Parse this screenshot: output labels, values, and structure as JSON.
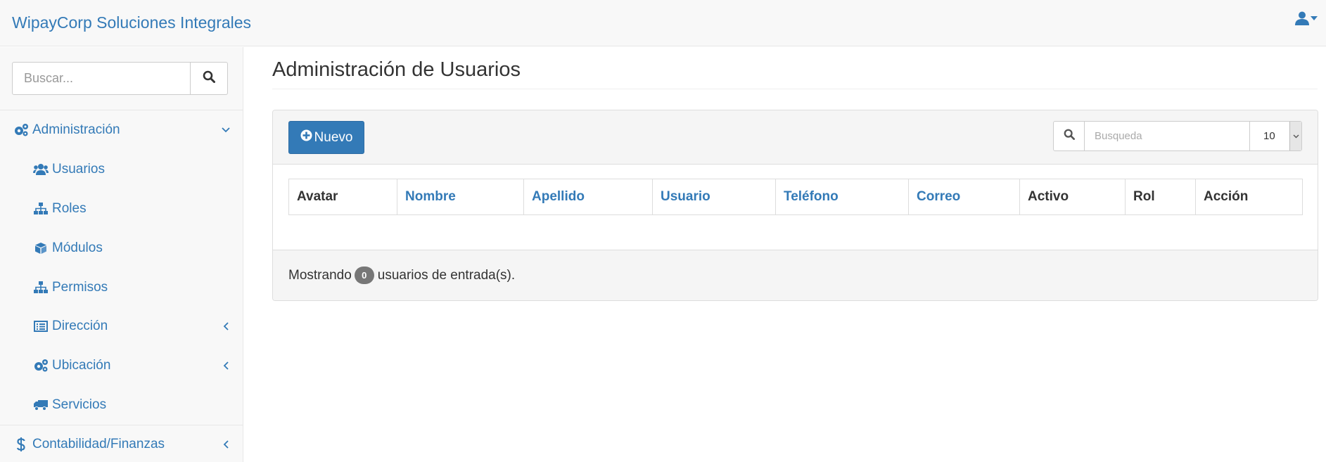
{
  "app": {
    "brand": "WipayCorp Soluciones Integrales"
  },
  "sidebar": {
    "search_placeholder": "Buscar...",
    "items": [
      {
        "label": "Administración",
        "icon": "cogs-icon",
        "level": "top",
        "chevron": "down"
      },
      {
        "label": "Usuarios",
        "icon": "users-icon",
        "level": "sub"
      },
      {
        "label": "Roles",
        "icon": "sitemap-icon",
        "level": "sub"
      },
      {
        "label": "Módulos",
        "icon": "cube-icon",
        "level": "sub"
      },
      {
        "label": "Permisos",
        "icon": "sitemap-icon",
        "level": "sub"
      },
      {
        "label": "Dirección",
        "icon": "list-alt-icon",
        "level": "sub",
        "chevron": "left"
      },
      {
        "label": "Ubicación",
        "icon": "cogs-icon",
        "level": "sub",
        "chevron": "left"
      },
      {
        "label": "Servicios",
        "icon": "truck-icon",
        "level": "sub"
      },
      {
        "label": "Contabilidad/Finanzas",
        "icon": "dollar-icon",
        "level": "top",
        "chevron": "left"
      }
    ]
  },
  "page": {
    "title": "Administración de Usuarios",
    "new_button": "Nuevo",
    "filter_placeholder": "Busqueda",
    "page_size": "10",
    "columns": [
      "Avatar",
      "Nombre",
      "Apellido",
      "Usuario",
      "Teléfono",
      "Correo",
      "Activo",
      "Rol",
      "Acción"
    ],
    "footer": {
      "prefix": "Mostrando",
      "count": "0",
      "suffix": "usuarios de entrada(s)."
    }
  },
  "colors": {
    "accent": "#337ab7",
    "nav_bg": "#f8f8f8",
    "badge": "#777777"
  }
}
